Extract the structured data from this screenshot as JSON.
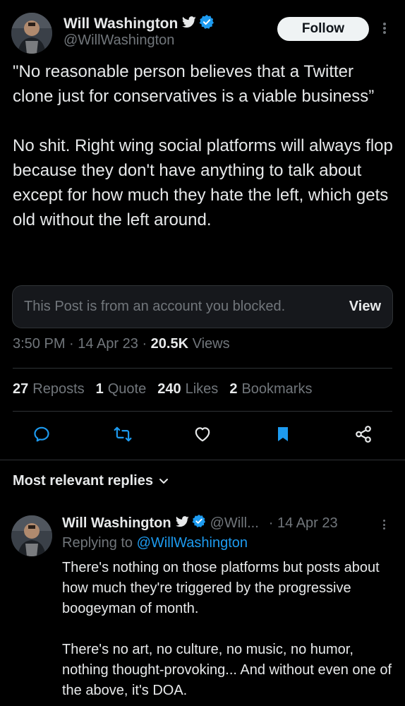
{
  "tweet": {
    "display_name": "Will Washington",
    "handle": "@WillWashington",
    "follow_label": "Follow",
    "text": "\"No reasonable person believes that a Twitter clone just for conservatives is a viable business”\n\nNo shit. Right wing social platforms will always flop because they don't have anything to talk about except for how much they hate the left, which gets old without the left around.",
    "blocked_notice": "This Post is from an account you blocked.",
    "blocked_view_label": "View",
    "time": "3:50 PM · 14 Apr 23 · ",
    "views_count": "20.5K",
    "views_label": " Views",
    "stats": {
      "reposts_count": "27",
      "reposts_label": "Reposts",
      "quotes_count": "1",
      "quotes_label": "Quote",
      "likes_count": "240",
      "likes_label": "Likes",
      "bookmarks_count": "2",
      "bookmarks_label": "Bookmarks"
    },
    "actions": {
      "reply_icon": "reply-icon",
      "repost_icon": "repost-icon",
      "like_icon": "heart-icon",
      "bookmark_icon": "bookmark-icon",
      "share_icon": "share-icon",
      "bookmark_color": "#1d9bf0"
    }
  },
  "replies_header": {
    "label": "Most relevant replies"
  },
  "reply": {
    "display_name": "Will Washington",
    "handle": "@Will...",
    "date": "· 14 Apr 23",
    "replying_prefix": "Replying to ",
    "replying_to": "@WillWashington",
    "text": "There's nothing on those platforms but posts about how much they're triggered by the progressive boogeyman of month.\n\nThere's no art, no culture, no music, no humor, nothing thought-provoking... And without even one of the above, it's DOA."
  },
  "colors": {
    "background": "#000000",
    "text": "#e7e9ea",
    "muted": "#71767b",
    "accent": "#1d9bf0",
    "divider": "#2f3336"
  }
}
